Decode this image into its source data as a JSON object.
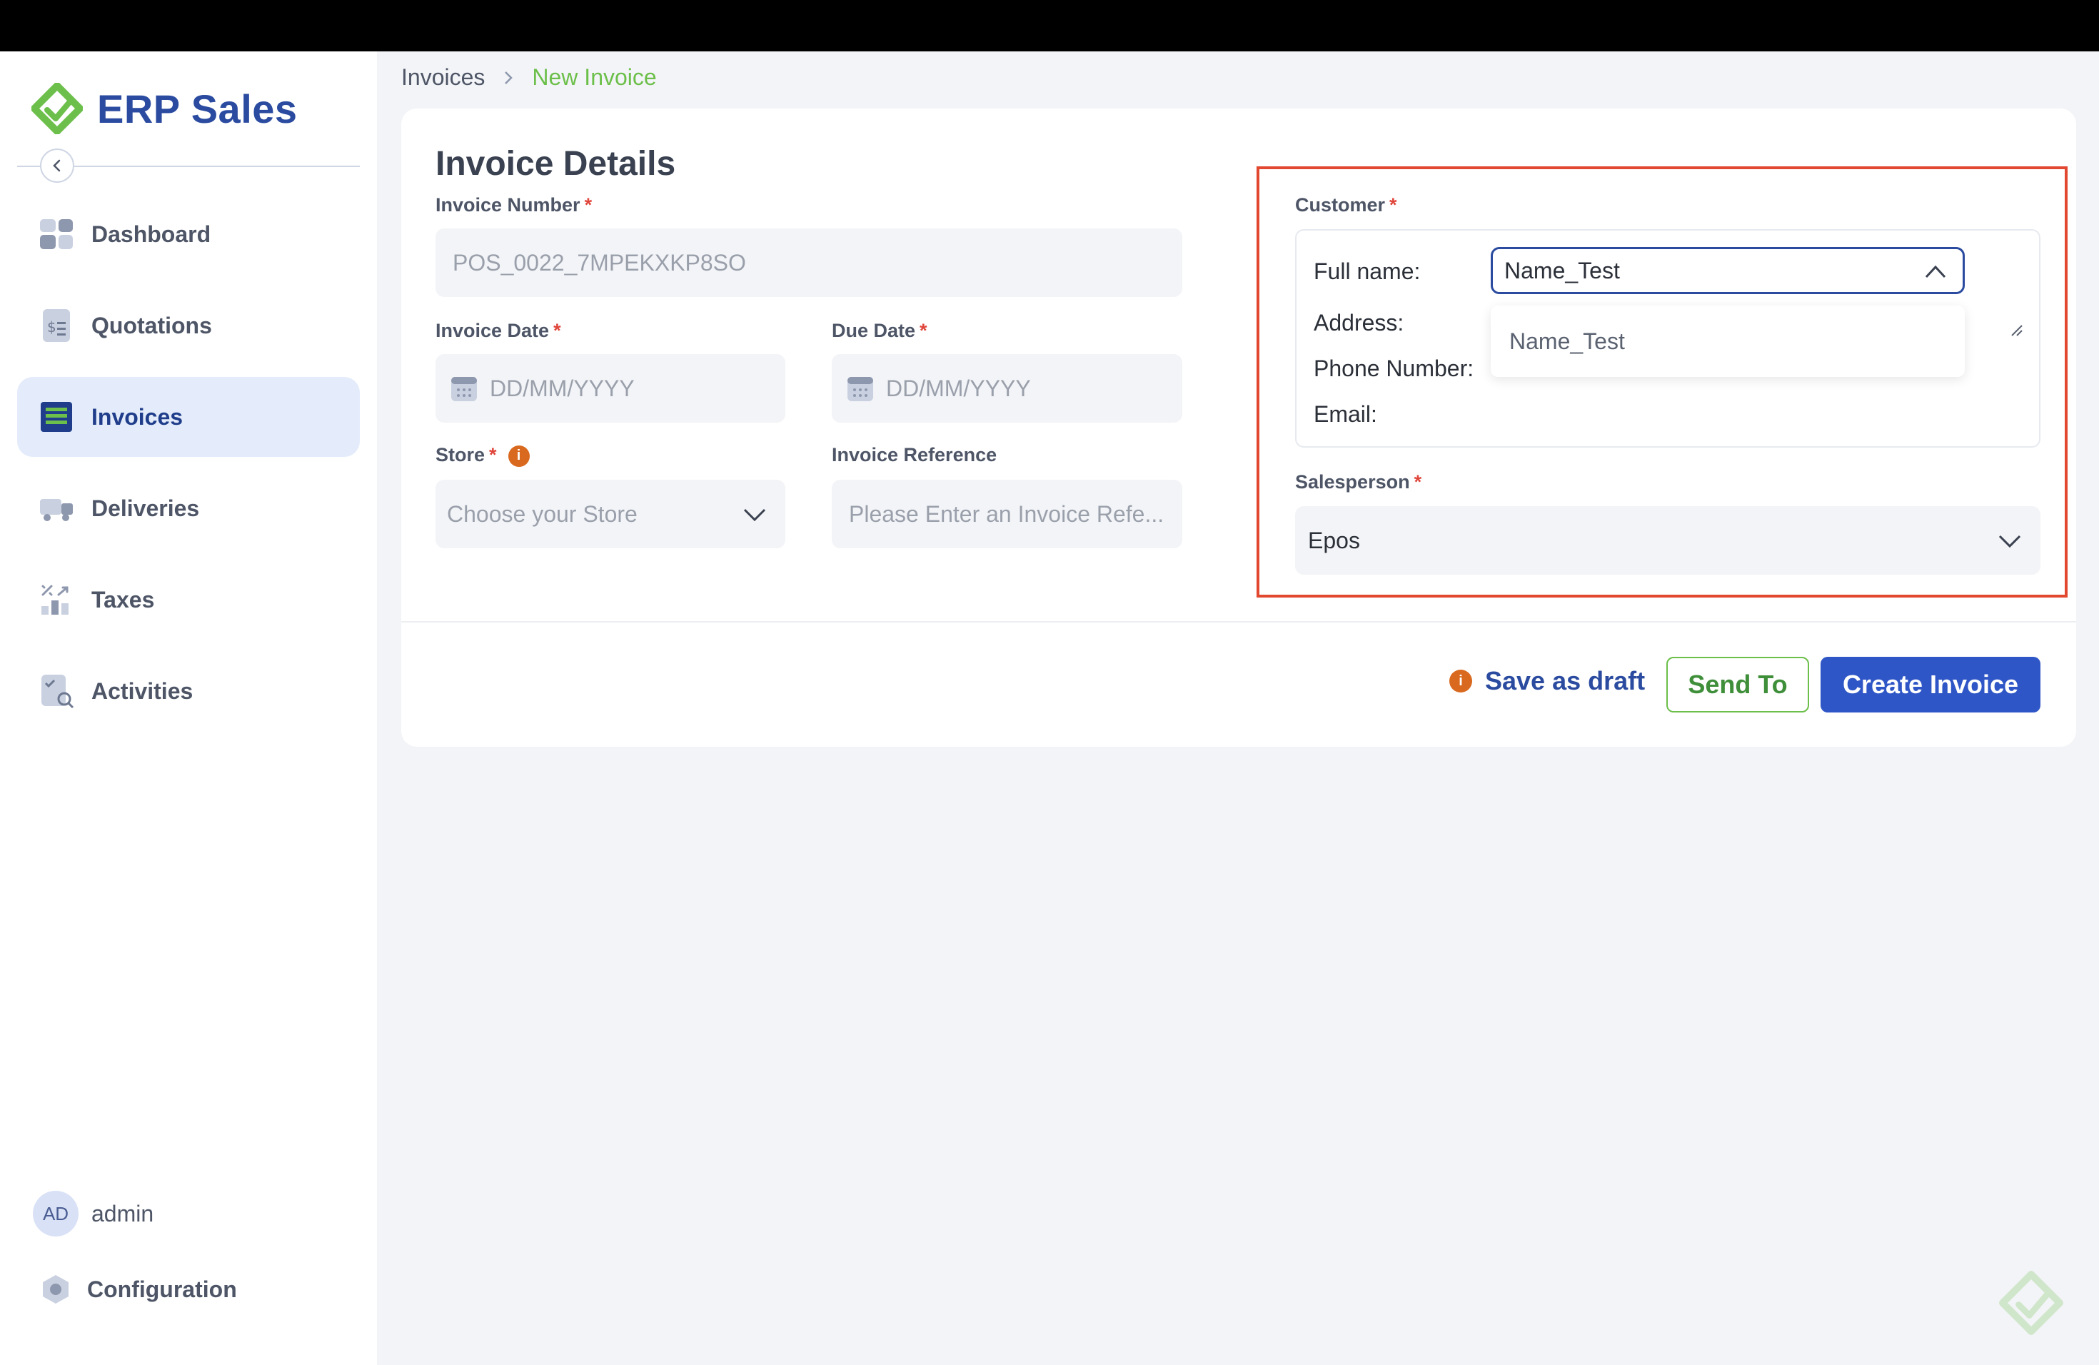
{
  "app": {
    "name": "ERP Sales",
    "accent": "#2a4b9f",
    "brand_green": "#6cbf4a"
  },
  "sidebar": {
    "items": [
      {
        "label": "Dashboard",
        "icon": "dashboard-icon"
      },
      {
        "label": "Quotations",
        "icon": "quotation-icon"
      },
      {
        "label": "Invoices",
        "icon": "invoice-icon",
        "active": true
      },
      {
        "label": "Deliveries",
        "icon": "truck-icon"
      },
      {
        "label": "Taxes",
        "icon": "taxes-icon"
      },
      {
        "label": "Activities",
        "icon": "activities-icon"
      }
    ],
    "user": {
      "initials": "AD",
      "name": "admin"
    },
    "config_label": "Configuration"
  },
  "breadcrumb": {
    "parent": "Invoices",
    "current": "New Invoice"
  },
  "form": {
    "title": "Invoice Details",
    "invoice_number": {
      "label": "Invoice Number",
      "required": "*",
      "value": "POS_0022_7MPEKXKP8SO"
    },
    "invoice_date": {
      "label": "Invoice Date",
      "required": "*",
      "placeholder": "DD/MM/YYYY"
    },
    "due_date": {
      "label": "Due Date",
      "required": "*",
      "placeholder": "DD/MM/YYYY"
    },
    "store": {
      "label": "Store",
      "required": "*",
      "placeholder": "Choose your Store",
      "info": "i"
    },
    "invoice_reference": {
      "label": "Invoice Reference",
      "placeholder": "Please Enter an Invoice Refe..."
    },
    "customer": {
      "label": "Customer",
      "required": "*",
      "full_name_label": "Full name:",
      "address_label": "Address:",
      "phone_label": "Phone Number:",
      "email_label": "Email:",
      "selected": "Name_Test",
      "options": [
        "Name_Test"
      ]
    },
    "salesperson": {
      "label": "Salesperson",
      "required": "*",
      "value": "Epos"
    }
  },
  "actions": {
    "draft": "Save as draft",
    "draft_info": "i",
    "send_to": "Send To",
    "create": "Create Invoice"
  }
}
